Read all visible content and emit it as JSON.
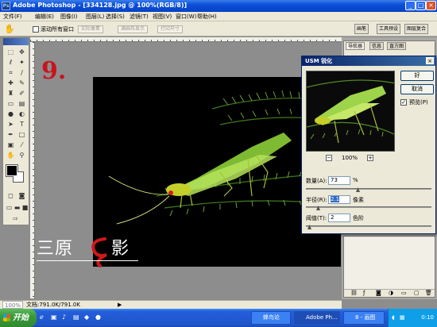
{
  "titlebar": {
    "title": "Adobe Photoshop - [334128.jpg @ 100%(RGB/8)]"
  },
  "menu": [
    "文件(F)",
    "编辑(E)",
    "图像(I)",
    "图层(L)",
    "选择(S)",
    "滤镜(T)",
    "视图(V)",
    "窗口(W)",
    "帮助(H)"
  ],
  "options": {
    "scroll_all_windows": "滚动所有窗口",
    "actual_pixels": "实际像素",
    "fit_screen": "满画布显示",
    "print_size": "打印尺寸"
  },
  "palette_well": [
    "画笔",
    "工具预设",
    "图层复合"
  ],
  "canvas_overlay": {
    "step_number": "9.",
    "watermark": "三原",
    "watermark_end": "影"
  },
  "navigator_tabs": [
    "导航器",
    "信息",
    "直方图"
  ],
  "usm": {
    "title": "USM 锐化",
    "ok": "好",
    "cancel": "取消",
    "preview_label": "预览(P)",
    "zoom": "100%",
    "amount_label": "数量(A):",
    "amount_value": "73",
    "amount_unit": "%",
    "radius_label": "半径(R):",
    "radius_value": "2.1",
    "radius_unit": "像素",
    "threshold_label": "阈值(T):",
    "threshold_value": "2",
    "threshold_unit": "色阶"
  },
  "status": {
    "zoom": "100%",
    "doc": "文档:791.0K/791.0K"
  },
  "taskbar": {
    "start": "开始",
    "tasks": [
      "蜂鸟论",
      "Adobe Ph...",
      "8 - 画图"
    ],
    "clock": "0:10"
  },
  "colors": {
    "accent": "#0a246a",
    "title_blue": "#0a4fd8",
    "step_red": "#c8141e"
  }
}
